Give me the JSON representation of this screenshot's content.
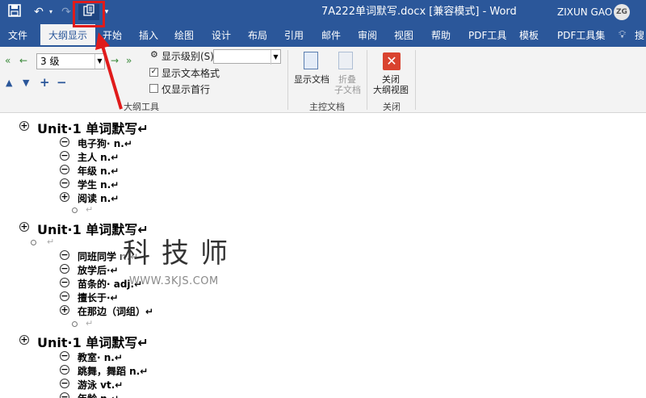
{
  "title_bar": {
    "document_title": "7A222单词默写.docx [兼容模式] - Word",
    "user_name": "ZIXUN GAO",
    "user_initials": "ZG",
    "qat": [
      "save-icon",
      "undo-icon",
      "redo-icon",
      "outline-view-icon",
      "customize-qat-icon"
    ]
  },
  "tabs": [
    "文件",
    "大纲显示",
    "开始",
    "插入",
    "绘图",
    "设计",
    "布局",
    "引用",
    "邮件",
    "审阅",
    "视图",
    "帮助",
    "PDF工具",
    "模板",
    "PDF工具集",
    "搜"
  ],
  "active_tab": "大纲显示",
  "ribbon": {
    "outline_tools": {
      "level_value": "3 级",
      "show_level_label": "显示级别(S):",
      "show_level_value": "",
      "show_text_formatting_label": "显示文本格式",
      "show_text_formatting_checked": true,
      "show_first_line_only_label": "仅显示首行",
      "show_first_line_only_checked": false,
      "group_label": "大纲工具"
    },
    "master_document": {
      "show_document_label": "显示文档",
      "collapse_line1": "折叠",
      "collapse_line2": "子文档",
      "group_label": "主控文档"
    },
    "close": {
      "close_line1": "关闭",
      "close_line2": "大纲视图",
      "group_label": "关闭"
    }
  },
  "document": [
    {
      "level": 1,
      "symbol": "plus",
      "text": "Unit·1 单词默写↵"
    },
    {
      "level": 3,
      "symbol": "minus",
      "text": "电子狗· n.↵"
    },
    {
      "level": 3,
      "symbol": "minus",
      "text": "主人 n.↵"
    },
    {
      "level": 3,
      "symbol": "minus",
      "text": "年级 n.↵"
    },
    {
      "level": 3,
      "symbol": "minus",
      "text": "学生 n.↵"
    },
    {
      "level": 3,
      "symbol": "plus",
      "text": "阅读 n.↵"
    },
    {
      "level": 4,
      "symbol": "dot",
      "text": "↵"
    },
    {
      "level": 1,
      "symbol": "plus",
      "text": "Unit·1 单词默写↵"
    },
    {
      "level": 0,
      "symbol": "dot",
      "text": "↵"
    },
    {
      "level": 3,
      "symbol": "minus",
      "text": "同班同学 n.↵"
    },
    {
      "level": 3,
      "symbol": "minus",
      "text": "放学后·↵"
    },
    {
      "level": 3,
      "symbol": "minus",
      "text": "苗条的· adj.↵"
    },
    {
      "level": 3,
      "symbol": "minus",
      "text": "擅长于·↵"
    },
    {
      "level": 3,
      "symbol": "plus",
      "text": "在那边（词组）↵"
    },
    {
      "level": 4,
      "symbol": "dot",
      "text": "↵"
    },
    {
      "level": 1,
      "symbol": "plus",
      "text": "Unit·1 单词默写↵"
    },
    {
      "level": 3,
      "symbol": "minus",
      "text": "教室· n.↵"
    },
    {
      "level": 3,
      "symbol": "minus",
      "text": "跳舞，舞蹈 n.↵"
    },
    {
      "level": 3,
      "symbol": "minus",
      "text": "游泳 vt.↵"
    },
    {
      "level": 3,
      "symbol": "minus",
      "text": "年龄 n.↵"
    }
  ],
  "watermark": {
    "chars": [
      "科",
      "技",
      "师"
    ],
    "url": "WWW.3KJS.COM"
  },
  "colors": {
    "word_blue": "#2b579a",
    "ribbon_bg": "#f3f3f3",
    "highlight_red": "#e01b1b",
    "close_red": "#d9432f"
  }
}
